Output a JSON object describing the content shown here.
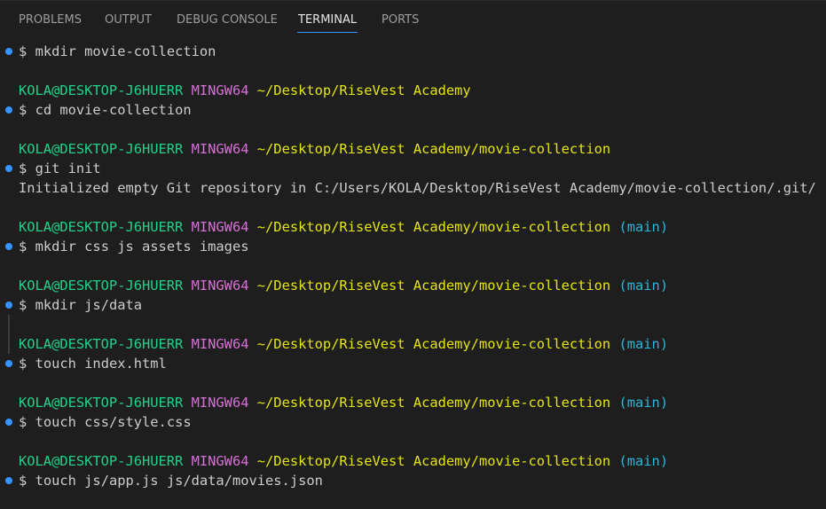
{
  "tabs": [
    {
      "label": "PROBLEMS",
      "active": false
    },
    {
      "label": "OUTPUT",
      "active": false
    },
    {
      "label": "DEBUG CONSOLE",
      "active": false
    },
    {
      "label": "TERMINAL",
      "active": true
    },
    {
      "label": "PORTS",
      "active": false
    }
  ],
  "terminal": {
    "user": "KOLA@DESKTOP-J6HUERR",
    "shell": "MINGW64",
    "path_root": "~/Desktop/RiseVest Academy",
    "path_repo": "~/Desktop/RiseVest Academy/movie-collection",
    "branch": "(main)",
    "prompt": "$",
    "commands": [
      "mkdir movie-collection",
      "cd movie-collection",
      "git init",
      "mkdir css js assets images",
      "mkdir js/data",
      "touch index.html",
      "touch css/style.css",
      "touch js/app.js js/data/movies.json"
    ],
    "output_git_init": "Initialized empty Git repository in C:/Users/KOLA/Desktop/RiseVest Academy/movie-collection/.git/"
  },
  "colors": {
    "background": "#1e1e1e",
    "user_host": "#23d18b",
    "shell_name": "#d670d6",
    "path": "#e5e510",
    "branch": "#29b8db",
    "decoration": "#3794ff",
    "tab_active_underline": "#3794ff"
  },
  "icons": [
    "command-decoration-icon"
  ]
}
